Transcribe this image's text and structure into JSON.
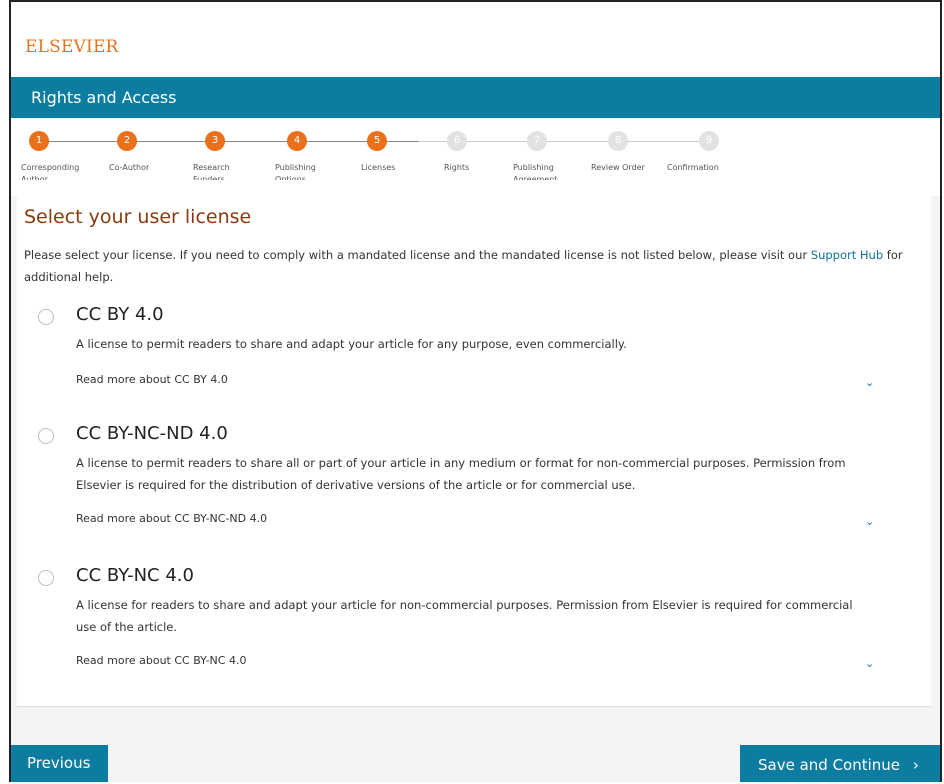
{
  "brand": {
    "logo_text": "ELSEVIER",
    "accent": "#e9711c",
    "primary": "#0c7ca0"
  },
  "banner": {
    "title": "Rights and Access"
  },
  "stepper": {
    "steps": [
      {
        "num": "1",
        "label": "Corresponding Author",
        "state": "done"
      },
      {
        "num": "2",
        "label": "Co-Author",
        "state": "done"
      },
      {
        "num": "3",
        "label": "Research Funders",
        "state": "done"
      },
      {
        "num": "4",
        "label": "Publishing Options",
        "state": "done"
      },
      {
        "num": "5",
        "label": "Licenses",
        "state": "done"
      },
      {
        "num": "6",
        "label": "Rights",
        "state": "todo"
      },
      {
        "num": "7",
        "label": "Publishing Agreement",
        "state": "todo"
      },
      {
        "num": "8",
        "label": "Review Order",
        "state": "todo"
      },
      {
        "num": "9",
        "label": "Confirmation",
        "state": "todo"
      }
    ]
  },
  "main": {
    "heading": "Select your user license",
    "intro_text": "Please select your license. If you need to comply with a mandated license and the mandated license is not listed below, please visit our",
    "intro_link": "Support Hub",
    "intro_suffix": "for additional help.",
    "options": [
      {
        "title": "CC BY 4.0",
        "desc": "A license to permit readers to share and adapt your article for any purpose, even commercially.",
        "readmore": "Read more about CC BY 4.0",
        "selected": false
      },
      {
        "title": "CC BY-NC-ND 4.0",
        "desc": "A license to permit readers to share all or part of your article in any medium or format for non-commercial purposes. Permission from Elsevier is required for the distribution of derivative versions of the article or for commercial use.",
        "readmore": "Read more about CC BY-NC-ND 4.0",
        "selected": false
      },
      {
        "title": "CC BY-NC 4.0",
        "desc": "A license for readers to share and adapt your article for non-commercial purposes. Permission from Elsevier is required for commercial use of the article.",
        "readmore": "Read more about CC BY-NC 4.0",
        "selected": false
      }
    ]
  },
  "footer": {
    "previous_label": "Previous",
    "next_label": "Save and Continue",
    "next_icon": "chevron-right-icon"
  }
}
